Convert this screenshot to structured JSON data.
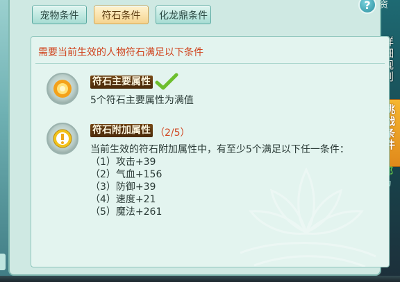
{
  "tabs": [
    {
      "label": "宠物条件",
      "active": false
    },
    {
      "label": "符石条件",
      "active": true
    },
    {
      "label": "化龙鼎条件",
      "active": false
    }
  ],
  "header": {
    "help_label": "?",
    "right_partial": "资"
  },
  "panel": {
    "headline": "需要当前生效的人物符石满足以下条件",
    "main_attr": {
      "tag": "符石主要属性",
      "desc": "5个符石主要属性为满值",
      "satisfied": true
    },
    "extra_attr": {
      "tag": "符石附加属性",
      "progress": "（2/5）",
      "desc": "当前生效的符石附加属性中，有至少5个满足以下任一条件：",
      "conditions": [
        "（1）攻击+39",
        "（2）气血+156",
        "（3）防御+39",
        "（4）速度+21",
        "（5）魔法+261"
      ]
    }
  },
  "right_sidebar": {
    "text1": "详细规则",
    "orange_button": "挑战条件",
    "green_text": "都",
    "small_text": "动"
  },
  "colors": {
    "accent_red": "#d0451f",
    "panel_bg": "#cfe9e3",
    "active_tab": "#f5d48f",
    "check_green": "#6dbf2e"
  }
}
